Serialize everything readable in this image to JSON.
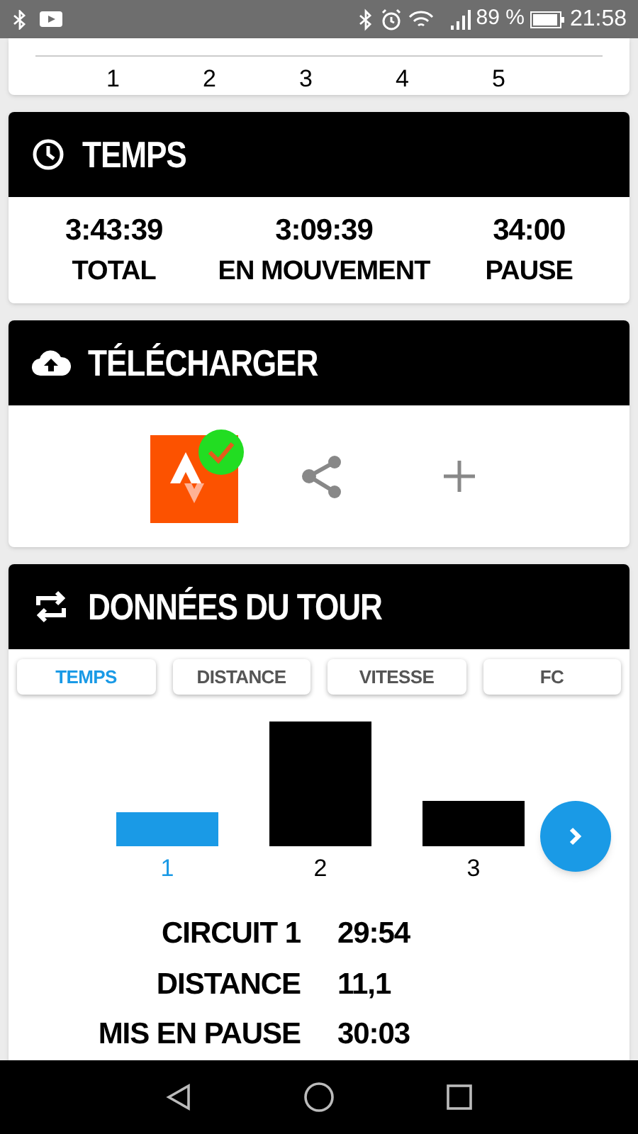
{
  "status_bar": {
    "battery_text": "89 %",
    "time": "21:58"
  },
  "top_chart": {
    "labels": [
      "1",
      "2",
      "3",
      "4",
      "5"
    ]
  },
  "temps": {
    "title": "TEMPS",
    "stats": [
      {
        "value": "3:43:39",
        "label": "TOTAL"
      },
      {
        "value": "3:09:39",
        "label": "EN MOUVEMENT"
      },
      {
        "value": "34:00",
        "label": "PAUSE"
      }
    ]
  },
  "upload": {
    "title": "TÉLÉCHARGER",
    "synced": true
  },
  "laps": {
    "title": "DONNÉES DU TOUR",
    "tabs": [
      {
        "label": "TEMPS",
        "selected": true
      },
      {
        "label": "DISTANCE",
        "selected": false
      },
      {
        "label": "VITESSE",
        "selected": false
      },
      {
        "label": "FC",
        "selected": false
      }
    ],
    "bars": [
      {
        "label": "1",
        "selected": true
      },
      {
        "label": "2",
        "selected": false
      },
      {
        "label": "3",
        "selected": false
      }
    ],
    "details": [
      {
        "label": "CIRCUIT 1",
        "value": "29:54"
      },
      {
        "label": "DISTANCE",
        "value": "11,1"
      },
      {
        "label": "MIS EN PAUSE",
        "value": "30:03"
      }
    ]
  }
}
